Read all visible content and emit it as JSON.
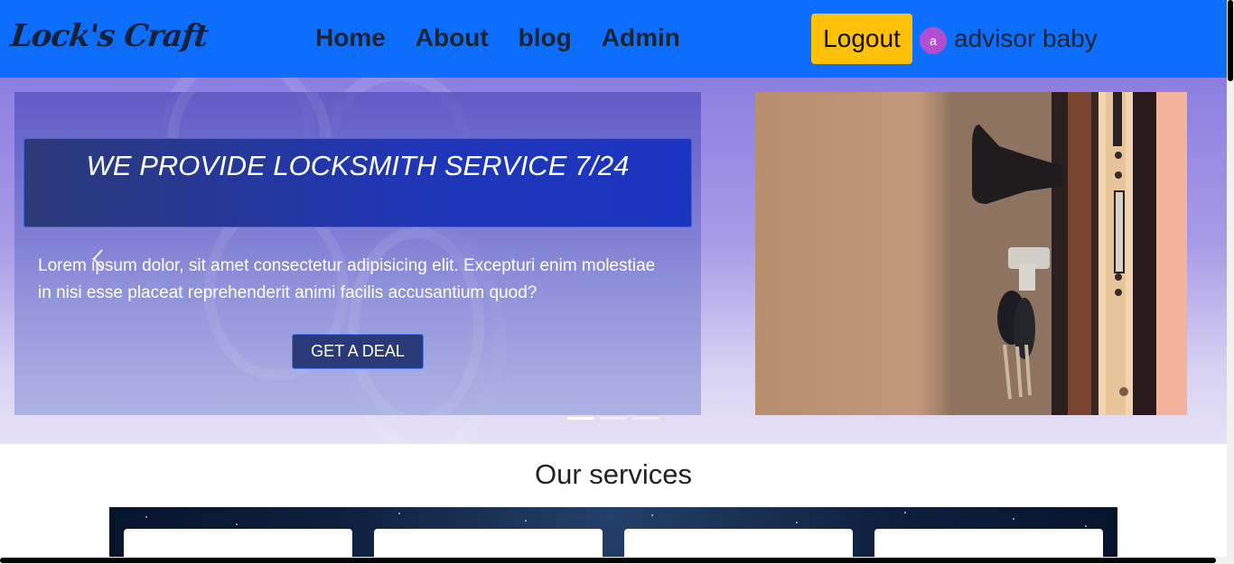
{
  "navbar": {
    "brand": "Lock's Craft",
    "links": [
      "Home",
      "About",
      "blog",
      "Admin"
    ],
    "logout_label": "Logout",
    "avatar_initial": "a",
    "username": "advisor baby",
    "bg_color": "#0d6efd",
    "logout_color": "#ffc107"
  },
  "hero": {
    "slide": {
      "title": "WE PROVIDE LOCKSMITH SERVICE 7/24",
      "text": "Lorem ipsum dolor, sit amet consectetur adipisicing elit. Excepturi enim molestiae in nisi esse placeat reprehenderit animi facilis accusantium quod?",
      "cta_label": "GET A DEAL"
    },
    "prev_icon": "chevron-left-icon",
    "indicators": {
      "count": 3,
      "active": 0
    }
  },
  "services": {
    "title": "Our services",
    "cards": 4
  }
}
